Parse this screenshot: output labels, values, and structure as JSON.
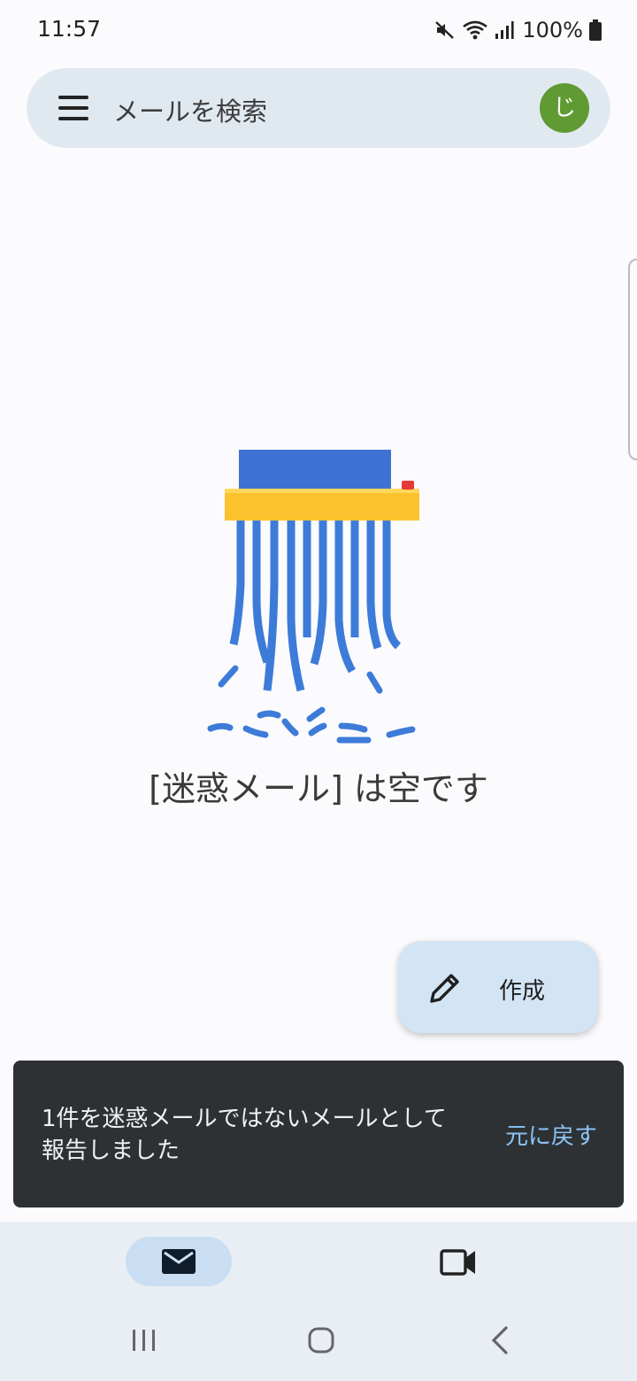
{
  "status_bar": {
    "time": "11:57",
    "battery": "100%",
    "icons": [
      "mute-icon",
      "wifi-icon",
      "signal-icon",
      "battery-icon"
    ]
  },
  "search": {
    "placeholder": "メールを検索",
    "avatar_initial": "じ",
    "avatar_color": "#5f9a32"
  },
  "empty_state": {
    "message": "[迷惑メール] は空です",
    "illustration": "paper-shredder"
  },
  "compose": {
    "label": "作成",
    "icon": "pencil-icon"
  },
  "snackbar": {
    "message": "1件を迷惑メールではないメールとして報告しました",
    "action": "元に戻す"
  },
  "bottom_nav": {
    "items": [
      {
        "icon": "mail-icon",
        "selected": true
      },
      {
        "icon": "video-camera-icon",
        "selected": false
      }
    ]
  },
  "system_nav": [
    "recent-apps-icon",
    "home-icon",
    "back-icon"
  ],
  "colors": {
    "search_bg": "#e1e9f0",
    "fab_bg": "#d3e4f4",
    "snackbar_bg": "#2e3134",
    "snackbar_action": "#8cc4f6",
    "nav_bg": "#e8eef4",
    "nav_selected_pill": "#c9def3",
    "shredder_paper": "#3d7bd9",
    "shredder_body": "#fbc22d"
  }
}
